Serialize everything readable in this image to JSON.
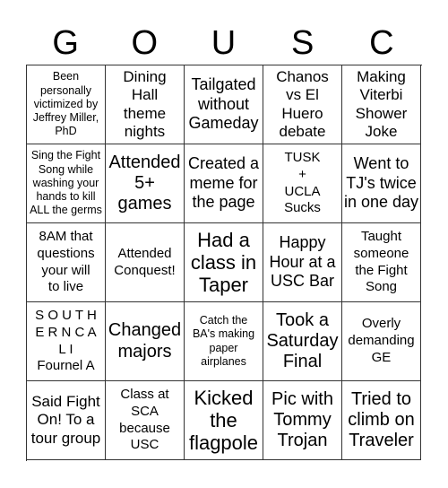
{
  "header": {
    "letters": [
      "G",
      "O",
      "U",
      "S",
      "C"
    ]
  },
  "cells": [
    {
      "text": "Been\npersonally\nvictimized by\nJeffrey Miller,\nPhD",
      "size": "fs-xs"
    },
    {
      "text": "Dining\nHall\ntheme\nnights",
      "size": "fs-m"
    },
    {
      "text": "Tailgated\nwithout\nGameday",
      "size": "fs-l"
    },
    {
      "text": "Chanos\nvs El\nHuero\ndebate",
      "size": "fs-m"
    },
    {
      "text": "Making\nViterbi\nShower\nJoke",
      "size": "fs-m"
    },
    {
      "text": "Sing the Fight\nSong while\nwashing your\nhands to kill\nALL the germs",
      "size": "fs-xs"
    },
    {
      "text": "Attended\n5+\ngames",
      "size": "fs-xl"
    },
    {
      "text": "Created a\nmeme for\nthe page",
      "size": "fs-l"
    },
    {
      "text": "TUSK\n+\nUCLA\nSucks",
      "size": "fs-s"
    },
    {
      "text": "Went to\nTJ's twice\nin one day",
      "size": "fs-l"
    },
    {
      "text": "8AM that\nquestions\nyour will\nto live",
      "size": "fs-s"
    },
    {
      "text": "Attended\nConquest!",
      "size": "fs-s"
    },
    {
      "text": "Had a\nclass in\nTaper",
      "size": "fs-xxl"
    },
    {
      "text": "Happy\nHour at a\nUSC Bar",
      "size": "fs-l"
    },
    {
      "text": "Taught\nsomeone\nthe Fight\nSong",
      "size": "fs-s"
    },
    {
      "text": "S O U T H\nE R N C A\nL I\nFournel A",
      "size": "fs-s"
    },
    {
      "text": "Changed\nmajors",
      "size": "fs-xl"
    },
    {
      "text": "Catch the\nBA's making\npaper\nairplanes",
      "size": "fs-xs"
    },
    {
      "text": "Took a\nSaturday\nFinal",
      "size": "fs-xl"
    },
    {
      "text": "Overly\ndemanding\nGE",
      "size": "fs-s"
    },
    {
      "text": "Said Fight\nOn! To a\ntour group",
      "size": "fs-m"
    },
    {
      "text": "Class at\nSCA\nbecause\nUSC",
      "size": "fs-s"
    },
    {
      "text": "Kicked\nthe\nflagpole",
      "size": "fs-xxl"
    },
    {
      "text": "Pic with\nTommy\nTrojan",
      "size": "fs-xl"
    },
    {
      "text": "Tried to\nclimb on\nTraveler",
      "size": "fs-xl"
    }
  ]
}
